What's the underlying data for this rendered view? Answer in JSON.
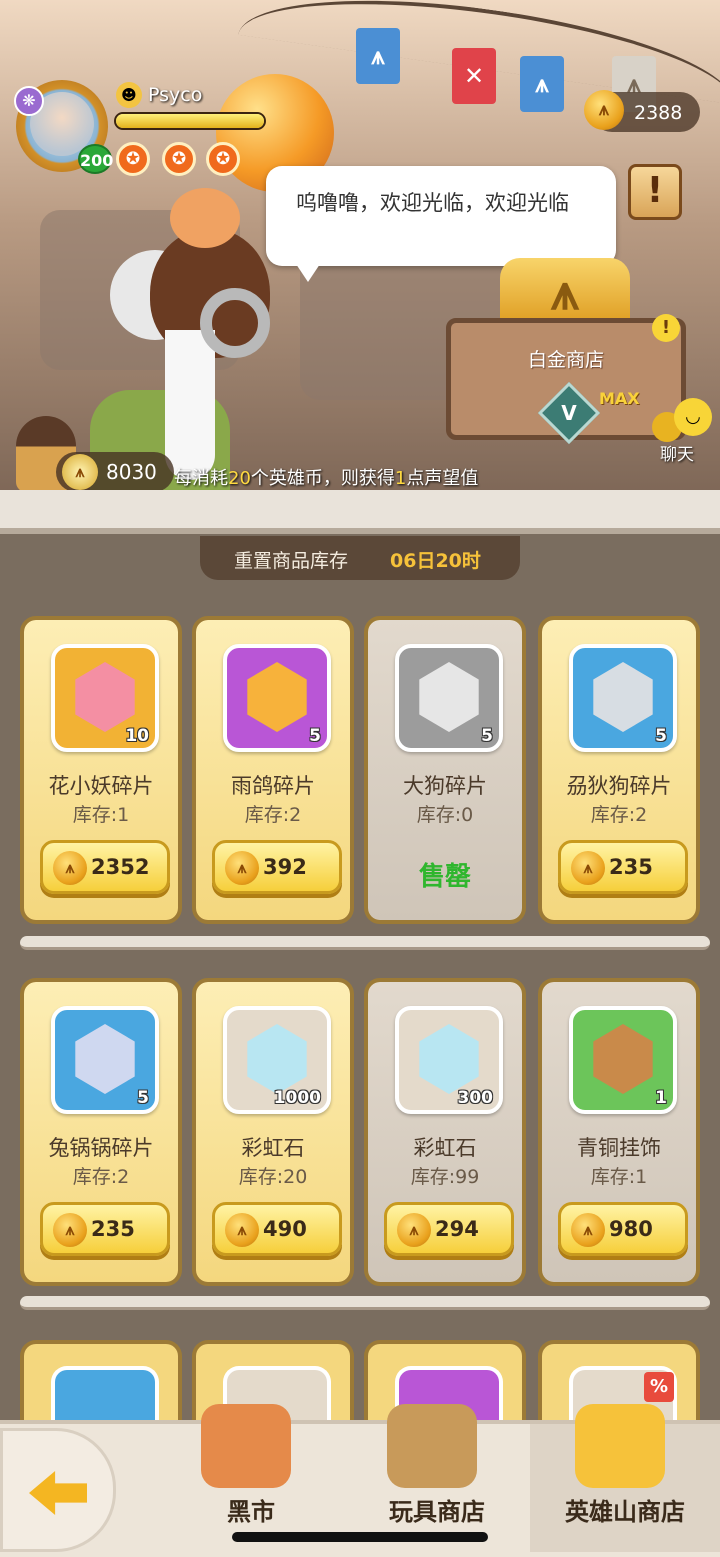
{
  "player": {
    "name": "Psyco",
    "level": "200",
    "xp_fraction": 1.0
  },
  "currency": {
    "icon": "gold-coin-icon",
    "value": "2388"
  },
  "npc": {
    "dialogue": "呜噜噜，欢迎光临，欢迎光临"
  },
  "shop_sign": {
    "title": "白金商店",
    "badge": "V",
    "max_label": "MAX"
  },
  "chat": {
    "label": "聊天"
  },
  "hero_coins": {
    "value": "8030",
    "tip_prefix": "每消耗",
    "tip_num1": "20",
    "tip_mid": "个英雄币，则获得",
    "tip_num2": "1",
    "tip_suffix": "点声望值"
  },
  "restock": {
    "label": "重置商品库存",
    "time": "06日20时"
  },
  "items": [
    {
      "name": "花小妖碎片",
      "stock": "库存:1",
      "qty": "10",
      "price": "2352",
      "tile_color": "#f2b234",
      "gem_color": "#f48fa3"
    },
    {
      "name": "雨鸽碎片",
      "stock": "库存:2",
      "qty": "5",
      "price": "392",
      "tile_color": "#b956d6",
      "gem_color": "#f7b23b"
    },
    {
      "name": "大狗碎片",
      "stock": "库存:0",
      "qty": "5",
      "sold": "售罄",
      "tile_color": "#9c9c9c",
      "gem_color": "#e6e6e6"
    },
    {
      "name": "刕狄狗碎片",
      "stock": "库存:2",
      "qty": "5",
      "price": "235",
      "tile_color": "#4aa7e0",
      "gem_color": "#d7dde3"
    },
    {
      "name": "兔锅锅碎片",
      "stock": "库存:2",
      "qty": "5",
      "price": "235",
      "tile_color": "#4aa7e0",
      "gem_color": "#cfd8f0"
    },
    {
      "name": "彩虹石",
      "stock": "库存:20",
      "qty": "1000",
      "price": "490",
      "tile_color": "#e4dacb",
      "gem_color": "#b8e6f2"
    },
    {
      "name": "彩虹石",
      "stock": "库存:99",
      "qty": "300",
      "price": "294",
      "tile_color": "#e4dacb",
      "gem_color": "#b8e6f2"
    },
    {
      "name": "青铜挂饰",
      "stock": "库存:1",
      "qty": "1",
      "price": "980",
      "tile_color": "#6cc55a",
      "gem_color": "#c98a4a"
    }
  ],
  "discount_badge": "%",
  "nav": {
    "back": "back-arrow-icon",
    "tabs": [
      {
        "label": "黑市"
      },
      {
        "label": "玩具商店"
      },
      {
        "label": "英雄山商店"
      }
    ]
  }
}
